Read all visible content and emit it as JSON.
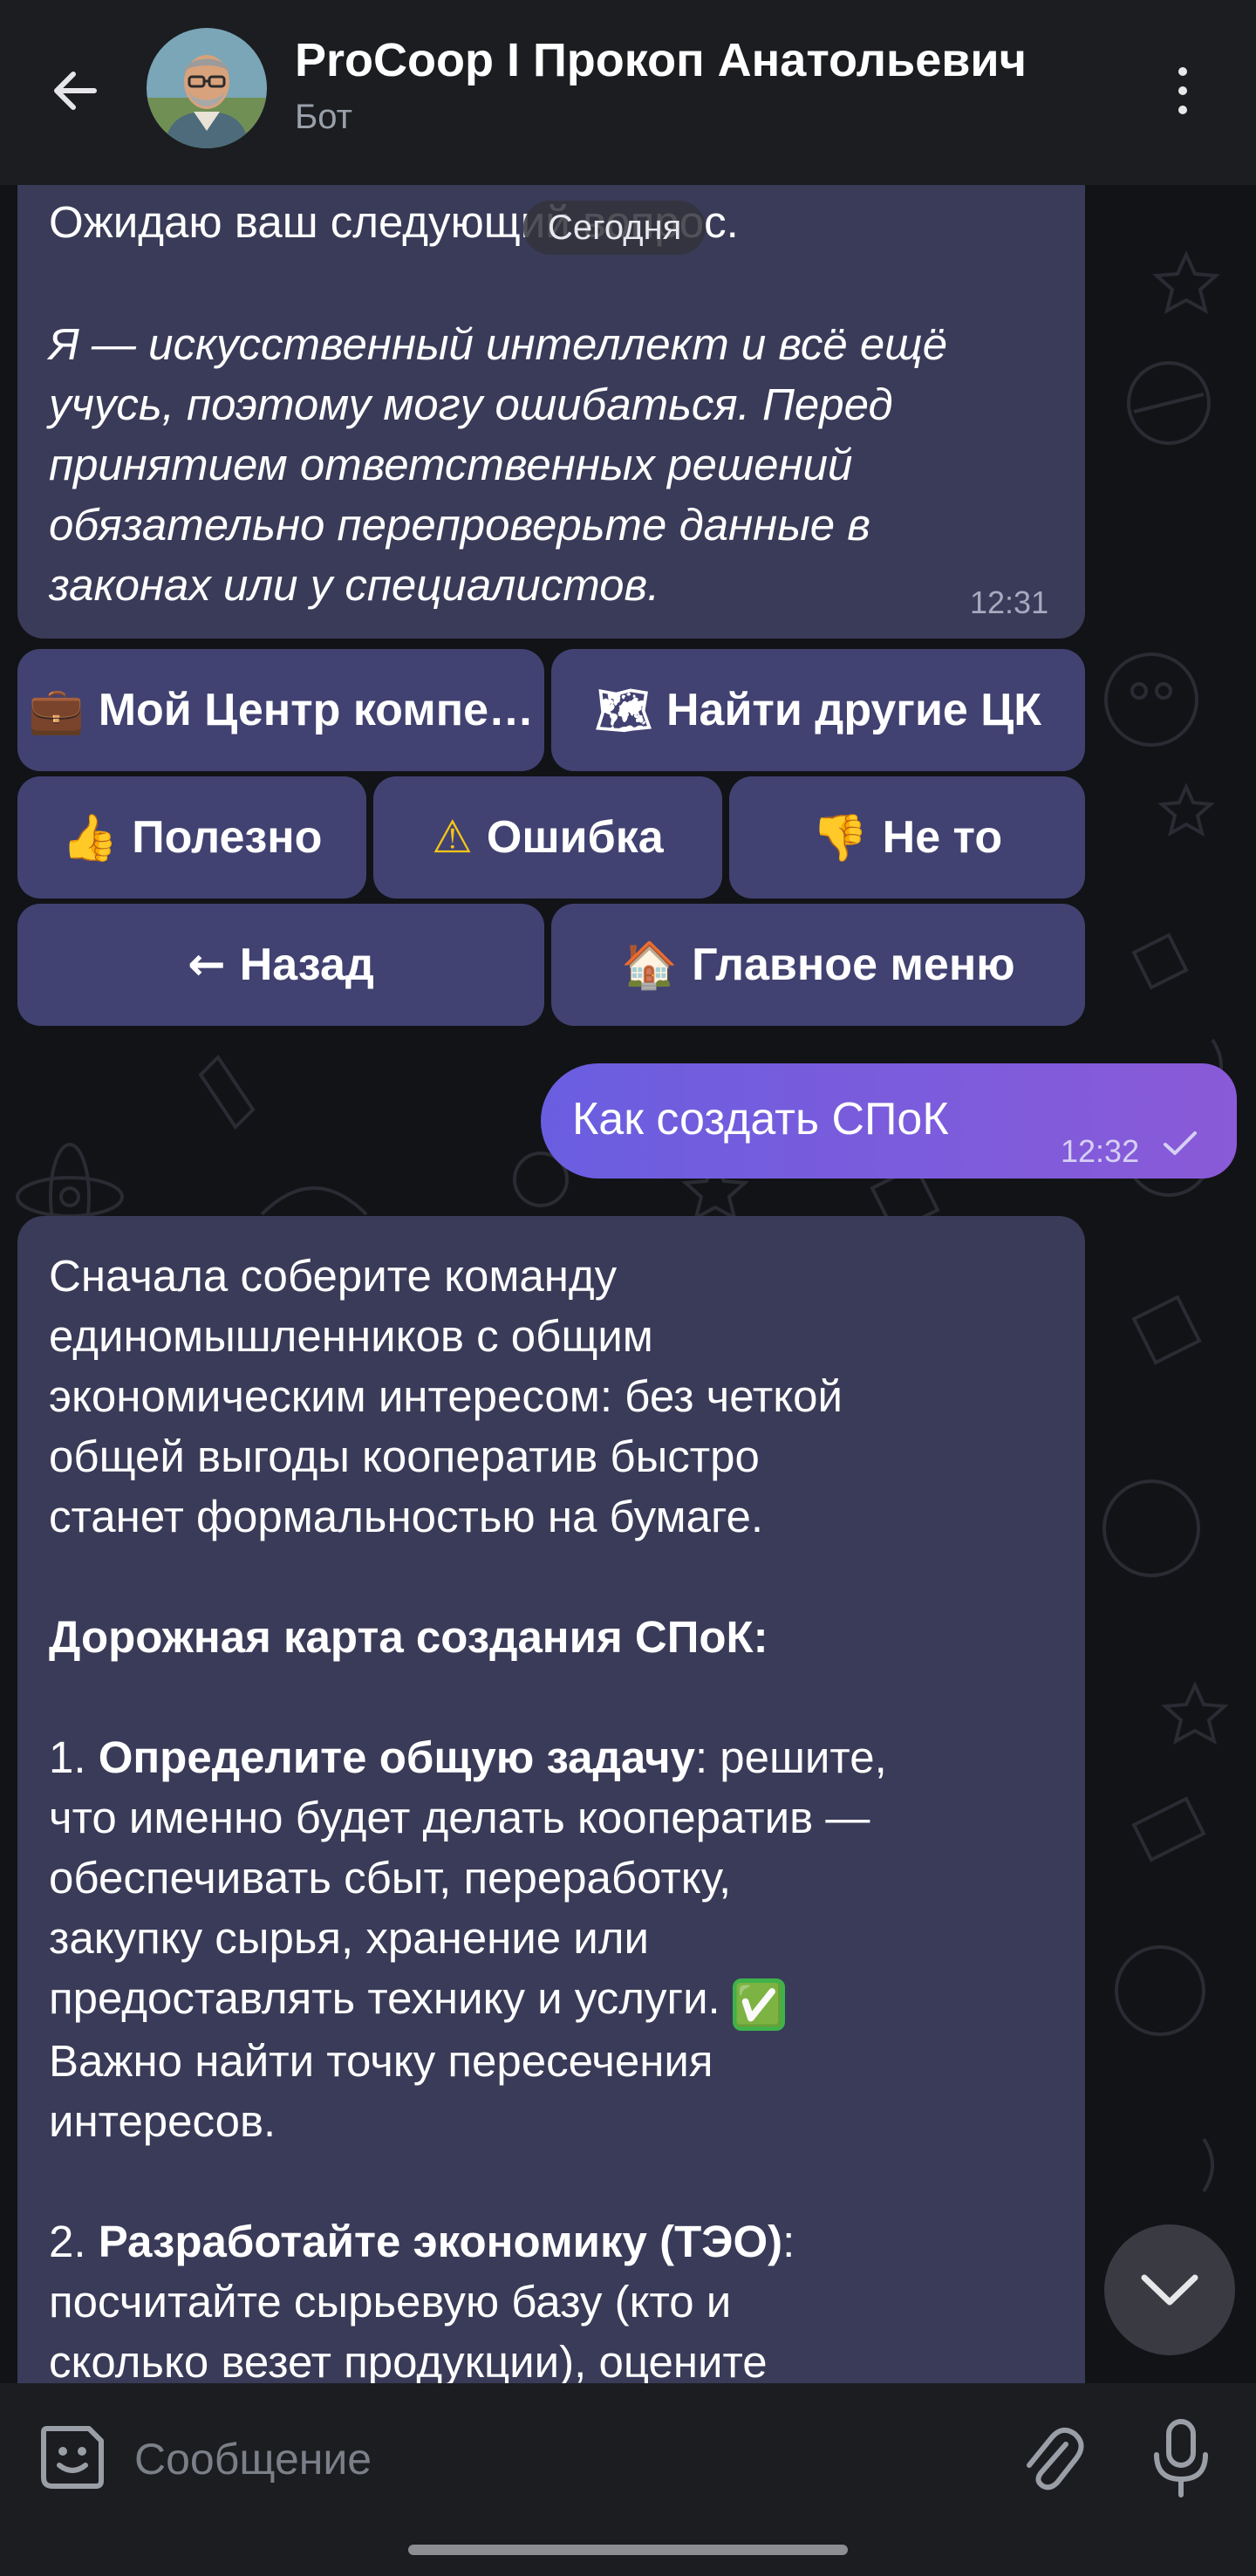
{
  "header": {
    "title": "ProCoop I Прокоп Анатольевич",
    "subtitle": "Бот"
  },
  "chat": {
    "date_divider": "Сегодня",
    "message1": {
      "line1": "Ожидаю ваш следующий вопрос.",
      "disclaimer": [
        "Я — искусственный интеллект и всё ещё",
        "учусь, поэтому могу ошибаться. Перед",
        "принятием ответственных решений",
        "обязательно перепроверьте данные в",
        "законах или у специалистов."
      ],
      "time": "12:31"
    },
    "keyboard": {
      "my_center": {
        "emoji": "💼",
        "label": "Мой Центр компе…"
      },
      "find_other": {
        "emoji": "🗺",
        "label": "Найти другие ЦК"
      },
      "useful": {
        "emoji": "👍",
        "label": "Полезно"
      },
      "error": {
        "emoji": "⚠",
        "label": "Ошибка"
      },
      "not_that": {
        "emoji": "👎",
        "label": "Не то"
      },
      "back": {
        "emoji": "←",
        "label": "Назад"
      },
      "main_menu": {
        "emoji": "🏠",
        "label": "Главное меню"
      }
    },
    "outgoing": {
      "text": "Как создать СПоК",
      "time": "12:32",
      "status": "sent"
    },
    "message2": {
      "intro": [
        "Сначала соберите команду",
        "единомышленников с общим",
        "экономическим интересом: без четкой",
        "общей выгоды кооператив быстро",
        "станет формальностью на бумаге."
      ],
      "roadmap_title": "Дорожная карта создания СПоК:",
      "step1_num": "1. ",
      "step1_bold": "Определите общую задачу",
      "step1_rest_first": ": решите,",
      "step1_lines": [
        "что именно будет делать кооператив —",
        "обеспечивать сбыт, переработку,",
        "закупку сырья, хранение или"
      ],
      "step1_line_emoji": "предоставлять технику и услуги. ",
      "step1_emoji": "✅",
      "step1_after": [
        "Важно найти точку пересечения",
        "интересов."
      ],
      "step2_num": "2. ",
      "step2_bold": "Разработайте экономику (ТЭО)",
      "step2_rest_first": ":",
      "step2_lines": [
        "посчитайте сырьевую базу (кто и",
        "сколько везет продукции), оцените"
      ]
    }
  },
  "input": {
    "placeholder": "Сообщение"
  },
  "colors": {
    "header_bg": "#1c1d21",
    "bubble_in": "#3a3b58",
    "keyboard_button": "#414271",
    "bubble_out_start": "#6a5ee0",
    "bubble_out_end": "#8a5ad8",
    "chat_bg": "#121317"
  },
  "icons": {
    "back": "arrow-left-icon",
    "menu": "more-vertical-icon",
    "scroll": "chevron-down-icon",
    "sticker": "sticker-icon",
    "attach": "paperclip-icon",
    "mic": "microphone-icon",
    "read_status": "check-icon"
  }
}
